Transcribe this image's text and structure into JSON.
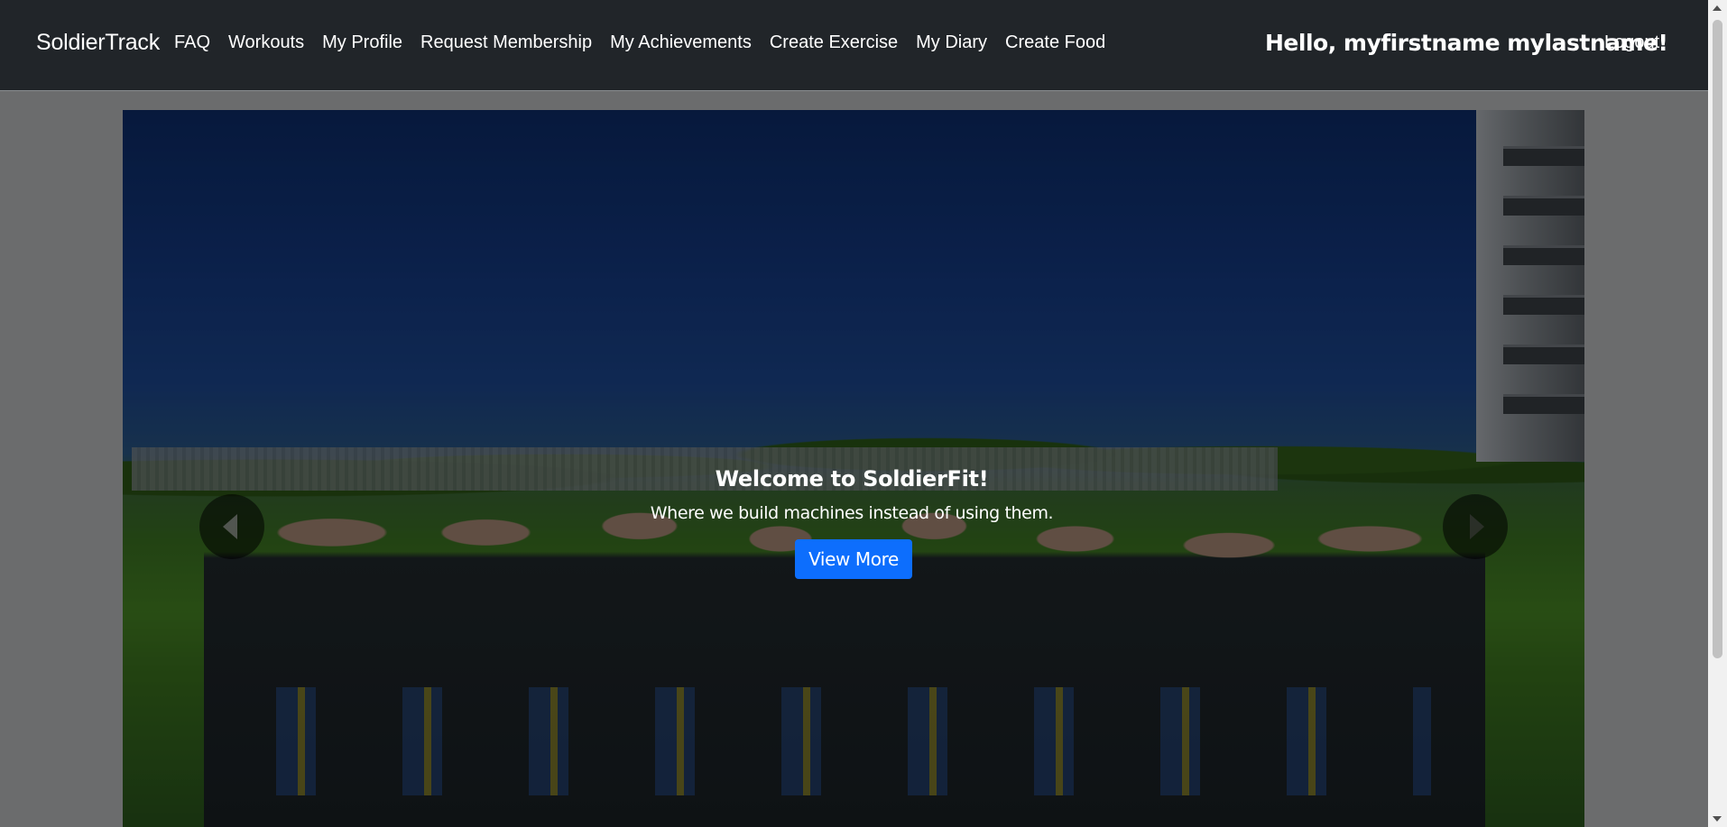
{
  "navbar": {
    "brand": "SoldierTrack",
    "links": [
      "FAQ",
      "Workouts",
      "My Profile",
      "Request Membership",
      "My Achievements",
      "Create Exercise",
      "My Diary",
      "Create Food"
    ],
    "greeting": "Hello, myfirstname mylastname!",
    "logout": "Logout"
  },
  "carousel": {
    "caption_title": "Welcome to SoldierFit!",
    "caption_text": "Where we build machines instead of using them.",
    "button_label": "View More",
    "prev_icon": "chevron-left-icon",
    "next_icon": "chevron-right-icon"
  },
  "colors": {
    "navbar_bg": "#212529",
    "page_bg": "#6b6c6d",
    "button_bg": "#0d6efd"
  }
}
